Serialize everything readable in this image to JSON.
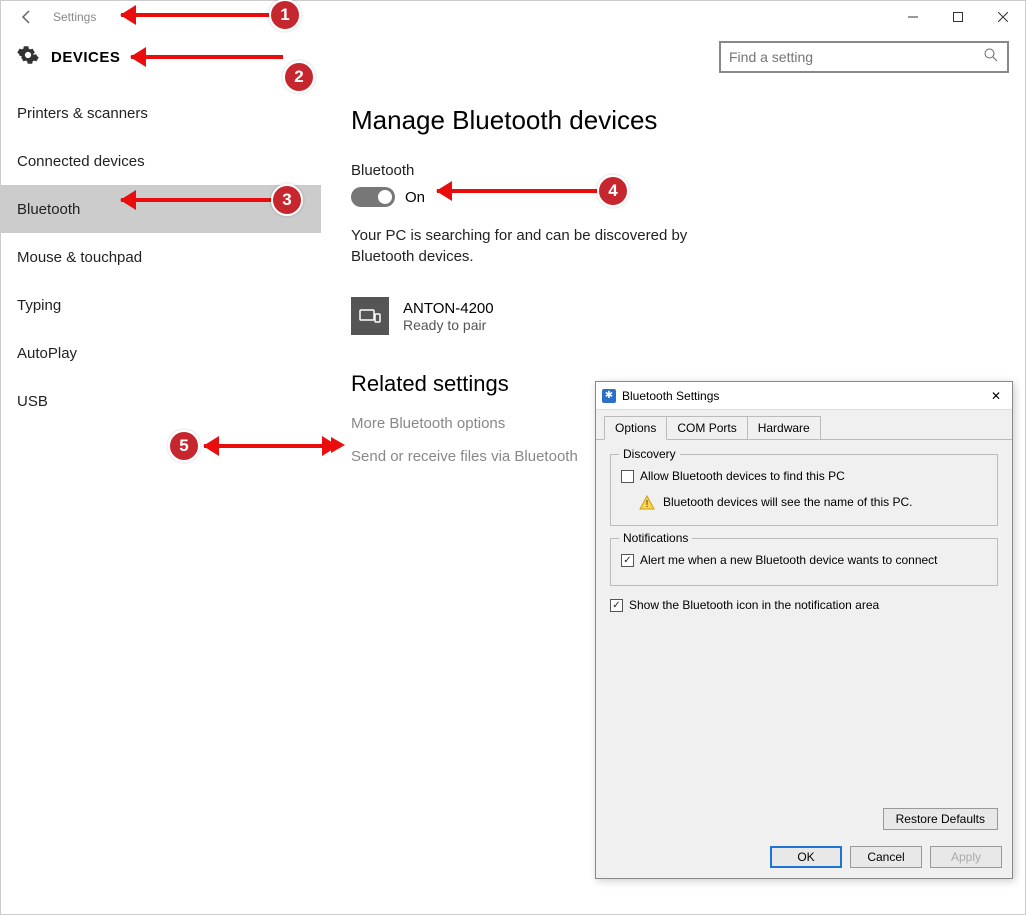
{
  "titlebar": {
    "title": "Settings"
  },
  "header": {
    "section": "DEVICES"
  },
  "search": {
    "placeholder": "Find a setting"
  },
  "sidebar": {
    "items": [
      "Printers & scanners",
      "Connected devices",
      "Bluetooth",
      "Mouse & touchpad",
      "Typing",
      "AutoPlay",
      "USB"
    ],
    "active_index": 2
  },
  "main": {
    "heading": "Manage Bluetooth devices",
    "toggle_label": "Bluetooth",
    "toggle_state": "On",
    "description": "Your PC is searching for and can be discovered by Bluetooth devices.",
    "device": {
      "name": "ANTON-4200",
      "status": "Ready to pair"
    },
    "related_heading": "Related settings",
    "link_more": "More Bluetooth options",
    "link_send": "Send or receive files via Bluetooth"
  },
  "dialog": {
    "title": "Bluetooth Settings",
    "tabs": [
      "Options",
      "COM Ports",
      "Hardware"
    ],
    "active_tab": 0,
    "group_discovery": "Discovery",
    "chk_discovery": "Allow Bluetooth devices to find this PC",
    "warn_text": "Bluetooth devices will see the name of this PC.",
    "group_notif": "Notifications",
    "chk_notif": "Alert me when a new Bluetooth device wants to connect",
    "chk_showicon": "Show the Bluetooth icon in the notification area",
    "btn_restore": "Restore Defaults",
    "btn_ok": "OK",
    "btn_cancel": "Cancel",
    "btn_apply": "Apply"
  },
  "callouts": [
    "1",
    "2",
    "3",
    "4",
    "5"
  ]
}
